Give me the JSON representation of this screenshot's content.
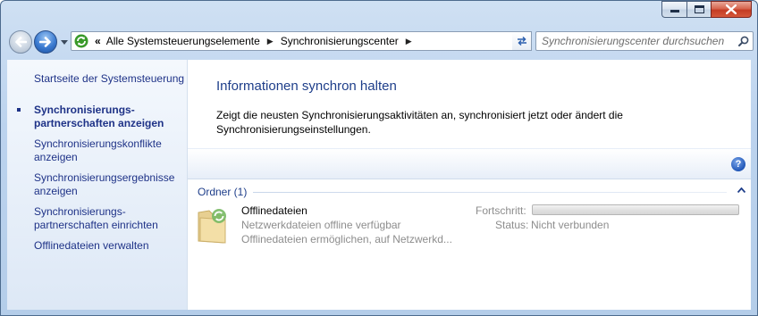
{
  "window": {
    "minimize_label": "–",
    "maximize_label": "□",
    "close_label": "✕"
  },
  "toolbar": {
    "breadcrumb": [
      "Alle Systemsteuerungselemente",
      "Synchronisierungscenter"
    ],
    "breadcrumb_overflow": "«",
    "search_placeholder": "Synchronisierungscenter durchsuchen"
  },
  "sidebar": {
    "home_link": "Startseite der Systemsteuerung",
    "items": [
      {
        "label": "Synchronisierungs- partnerschaften anzeigen",
        "lines": [
          "Synchronisierungs-",
          "partnerschaften anzeigen"
        ],
        "active": true
      },
      {
        "label": "Synchronisierungskonflikte anzeigen",
        "lines": [
          "Synchronisierungskonflikte",
          "anzeigen"
        ],
        "active": false
      },
      {
        "label": "Synchronisierungsergebnisse anzeigen",
        "lines": [
          "Synchronisierungsergebnisse",
          "anzeigen"
        ],
        "active": false
      },
      {
        "label": "Synchronisierungs- partnerschaften einrichten",
        "lines": [
          "Synchronisierungs-",
          "partnerschaften einrichten"
        ],
        "active": false
      },
      {
        "label": "Offlinedateien verwalten",
        "lines": [
          "Offlinedateien verwalten"
        ],
        "active": false
      }
    ]
  },
  "main": {
    "title": "Informationen synchron halten",
    "description": "Zeigt die neusten Synchronisierungsaktivitäten an, synchronisiert jetzt oder ändert die Synchronisierungseinstellungen.",
    "help_label": "?",
    "group": {
      "header": "Ordner (1)",
      "items": [
        {
          "name": "Offlinedateien",
          "subtitle_1": "Netzwerkdateien offline verfügbar",
          "subtitle_2": "Offlinedateien ermöglichen, auf Netzwerkd...",
          "progress_label": "Fortschritt:",
          "progress": 0,
          "status_label": "Status:",
          "status_value": "Nicht verbunden"
        }
      ]
    }
  },
  "colors": {
    "link": "#1e3287",
    "title": "#1e3e8a",
    "muted": "#8b8b8b",
    "frame": "#b4cde9"
  }
}
